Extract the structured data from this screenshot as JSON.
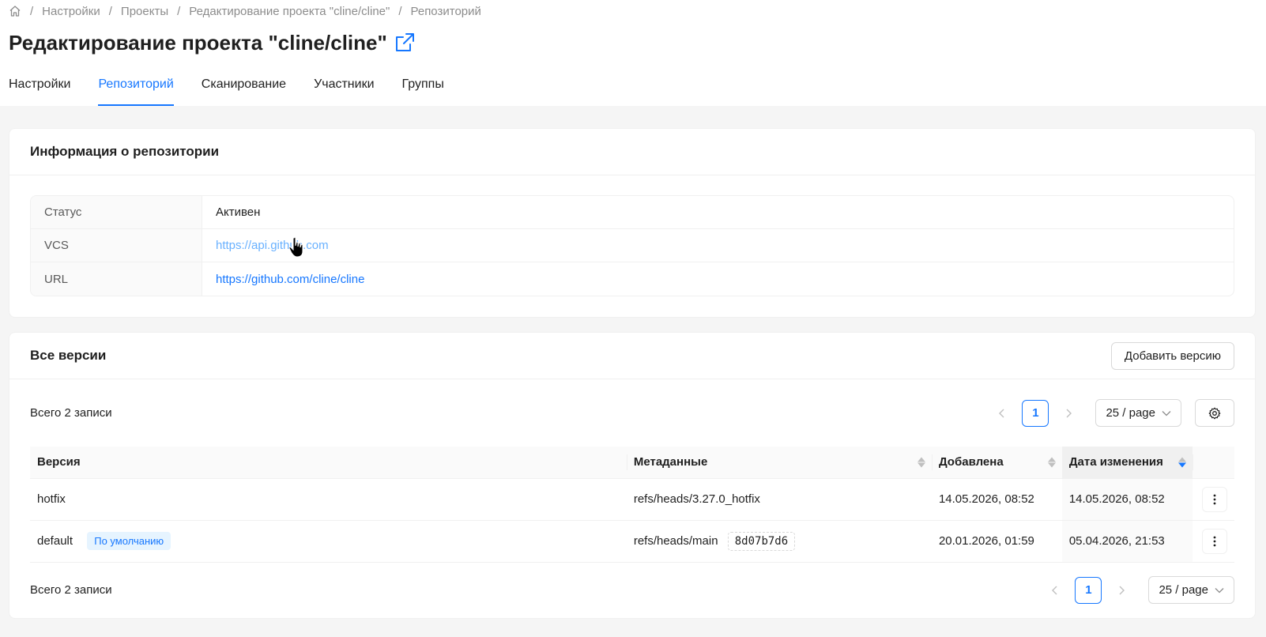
{
  "breadcrumb": {
    "home_icon": "home-icon",
    "items": [
      "Настройки",
      "Проекты",
      "Редактирование проекта \"cline/cline\"",
      "Репозиторий"
    ]
  },
  "page": {
    "title": "Редактирование проекта \"cline/cline\"",
    "external_link_icon": "external-link-icon"
  },
  "tabs": [
    "Настройки",
    "Репозиторий",
    "Сканирование",
    "Участники",
    "Группы"
  ],
  "active_tab": "Репозиторий",
  "repo_info": {
    "title": "Информация о репозитории",
    "rows": [
      {
        "label": "Статус",
        "value": "Активен"
      },
      {
        "label": "VCS",
        "value": "https://api.github.com"
      },
      {
        "label": "URL",
        "value": "https://github.com/cline/cline"
      }
    ]
  },
  "versions": {
    "title": "Все версии",
    "add_button": "Добавить версию",
    "total": "Всего 2 записи",
    "page": "1",
    "page_size": "25 / page",
    "columns": [
      "Версия",
      "Метаданные",
      "Добавлена",
      "Дата изменения"
    ],
    "rows": [
      {
        "version": "hotfix",
        "tag": "",
        "metadata": "refs/heads/3.27.0_hotfix",
        "commit": "",
        "added": "14.05.2026, 08:52",
        "modified": "14.05.2026, 08:52"
      },
      {
        "version": "default",
        "tag": "По умолчанию",
        "metadata": "refs/heads/main",
        "commit": "8d07b7d6",
        "added": "20.01.2026, 01:59",
        "modified": "05.04.2026, 21:53"
      }
    ]
  },
  "colors": {
    "accent": "#1677ff",
    "accent_hover": "#69b1ff"
  }
}
